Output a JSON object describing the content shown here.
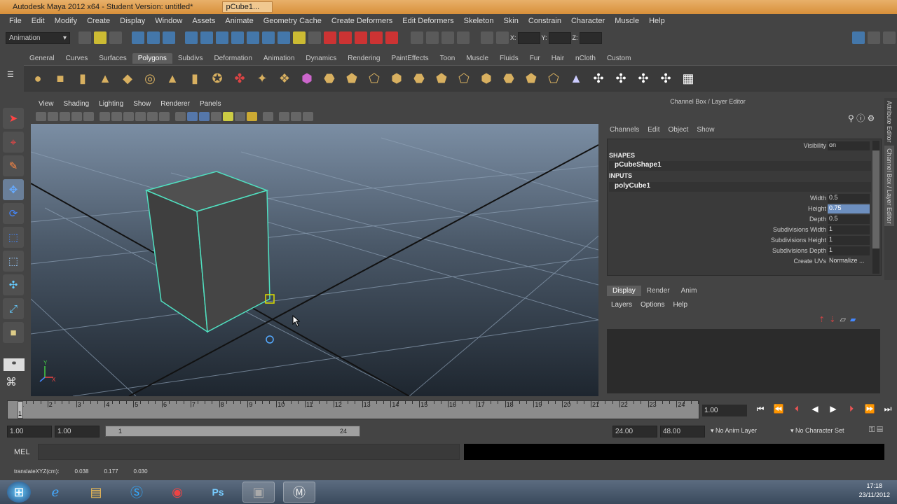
{
  "window": {
    "title": "Autodesk Maya 2012 x64 - Student Version: untitled*",
    "doc_tab": "pCube1..."
  },
  "menu": [
    "File",
    "Edit",
    "Modify",
    "Create",
    "Display",
    "Window",
    "Assets",
    "Animate",
    "Geometry Cache",
    "Create Deformers",
    "Edit Deformers",
    "Skeleton",
    "Skin",
    "Constrain",
    "Character",
    "Muscle",
    "Help"
  ],
  "status": {
    "menuset": "Animation",
    "coord_labels": {
      "x": "X:",
      "y": "Y:",
      "z": "Z:"
    }
  },
  "shelf_tabs": [
    "General",
    "Curves",
    "Surfaces",
    "Polygons",
    "Subdivs",
    "Deformation",
    "Animation",
    "Dynamics",
    "Rendering",
    "PaintEffects",
    "Toon",
    "Muscle",
    "Fluids",
    "Fur",
    "Hair",
    "nCloth",
    "Custom"
  ],
  "shelf_active": "Polygons",
  "panel_menu": [
    "View",
    "Shading",
    "Lighting",
    "Show",
    "Renderer",
    "Panels"
  ],
  "channel_box": {
    "title": "Channel Box / Layer Editor",
    "menu": [
      "Channels",
      "Edit",
      "Object",
      "Show"
    ],
    "visibility": {
      "label": "Visibility",
      "value": "on"
    },
    "shapes_header": "SHAPES",
    "shape_node": "pCubeShape1",
    "inputs_header": "INPUTS",
    "input_node": "polyCube1",
    "attrs": [
      {
        "label": "Width",
        "value": "0.5",
        "sel": false
      },
      {
        "label": "Height",
        "value": "0.75",
        "sel": true
      },
      {
        "label": "Depth",
        "value": "0.5",
        "sel": false
      },
      {
        "label": "Subdivisions Width",
        "value": "1",
        "sel": false
      },
      {
        "label": "Subdivisions Height",
        "value": "1",
        "sel": false
      },
      {
        "label": "Subdivisions Depth",
        "value": "1",
        "sel": false
      },
      {
        "label": "Create UVs",
        "value": "Normalize ...",
        "sel": false
      }
    ]
  },
  "side_tabs": [
    "Attribute Editor",
    "Channel Box / Layer Editor"
  ],
  "layer_editor": {
    "tabs": [
      "Display",
      "Render",
      "Anim"
    ],
    "active": "Display",
    "menu": [
      "Layers",
      "Options",
      "Help"
    ]
  },
  "timeline": {
    "ticks": [
      "1",
      "2",
      "3",
      "4",
      "5",
      "6",
      "7",
      "8",
      "9",
      "10",
      "11",
      "12",
      "13",
      "14",
      "15",
      "16",
      "17",
      "18",
      "19",
      "20",
      "21",
      "22",
      "23",
      "24"
    ],
    "current_frame": "1.00",
    "current_label": "1"
  },
  "range": {
    "start": "1.00",
    "anim_start": "1.00",
    "slider_start": "1",
    "slider_end": "24",
    "anim_end": "24.00",
    "end": "48.00",
    "anim_layer": "No Anim Layer",
    "character_set": "No Character Set"
  },
  "mel": {
    "label": "MEL"
  },
  "helpline": {
    "label": "translateXYZ(cm):",
    "x": "0.038",
    "y": "0.177",
    "z": "0.030"
  },
  "taskbar": {
    "time": "17:18",
    "date": "23/11/2012"
  },
  "colors": {
    "selection_wire": "#50e0c0",
    "active_tab": "#5e5e5e",
    "selected_field": "#6d8fbf"
  }
}
